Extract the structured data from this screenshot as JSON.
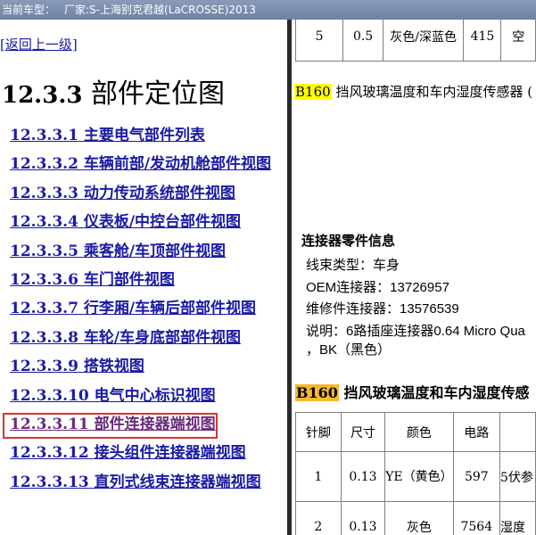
{
  "title_bar": {
    "label": "当前车型：",
    "model": "厂家:S-上海别克君越(LaCROSSE)2013"
  },
  "left": {
    "back_link": "[返回上一级]",
    "section_number": "12.3.3",
    "section_title": "部件定位图",
    "nav": [
      {
        "num": "12.3.3.1",
        "label": "主要电气部件列表"
      },
      {
        "num": "12.3.3.2",
        "label": "车辆前部/发动机舱部件视图"
      },
      {
        "num": "12.3.3.3",
        "label": "动力传动系统部件视图"
      },
      {
        "num": "12.3.3.4",
        "label": "仪表板/中控台部件视图"
      },
      {
        "num": "12.3.3.5",
        "label": "乘客舱/车顶部件视图"
      },
      {
        "num": "12.3.3.6",
        "label": "车门部件视图"
      },
      {
        "num": "12.3.3.7",
        "label": "行李厢/车辆后部部件视图"
      },
      {
        "num": "12.3.3.8",
        "label": "车轮/车身底部部件视图"
      },
      {
        "num": "12.3.3.9",
        "label": "搭铁视图"
      },
      {
        "num": "12.3.3.10",
        "label": "电气中心标识视图"
      },
      {
        "num": "12.3.3.11",
        "label": "部件连接器端视图"
      },
      {
        "num": "12.3.3.12",
        "label": "接头组件连接器端视图"
      },
      {
        "num": "12.3.3.13",
        "label": "直列式线束连接器端视图"
      }
    ]
  },
  "right": {
    "top_row": [
      "5",
      "0.5",
      "灰色/深蓝色",
      "415",
      "空"
    ],
    "caption1_tag": "B160",
    "caption1_text": "挡风玻璃温度和车内湿度传感器 (",
    "info_title": "连接器零件信息",
    "info": [
      "线束类型：车身",
      "OEM连接器：13726957",
      "维修件连接器：13576539",
      "说明：6路插座连接器0.64 Micro Qua",
      "，BK（黑色）"
    ],
    "caption2_tag": "B160",
    "caption2_text": "挡风玻璃温度和车内湿度传感",
    "table_headers": [
      "针脚",
      "尺寸",
      "颜色",
      "电路",
      ""
    ],
    "rows": [
      [
        "1",
        "0.13",
        "YE（黄色）",
        "597",
        "5伏参"
      ],
      [
        "2",
        "0.13",
        "灰色",
        "7564",
        "湿度"
      ]
    ]
  }
}
